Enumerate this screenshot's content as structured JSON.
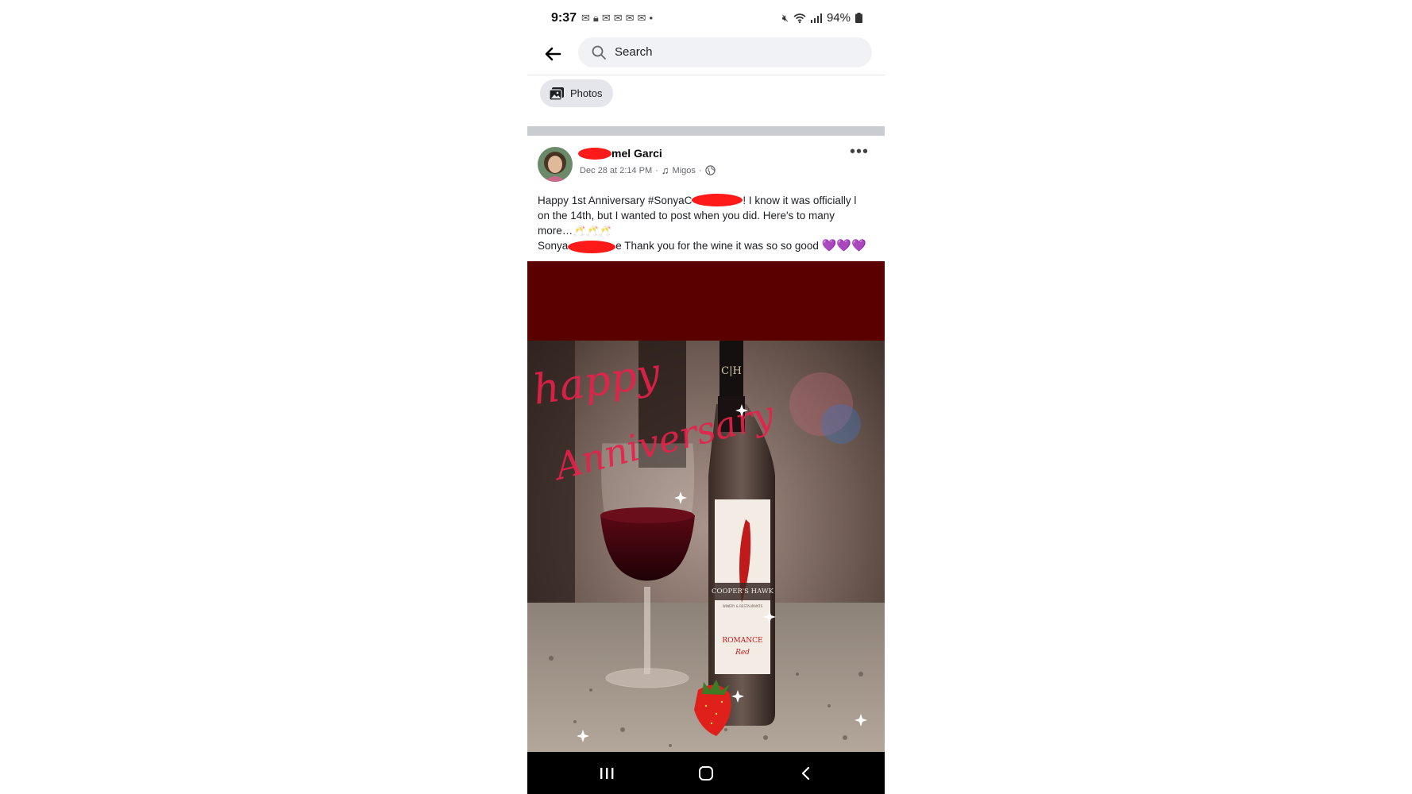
{
  "status_bar": {
    "time": "9:37",
    "notifications": [
      "gmail-icon",
      "lock-icon",
      "gmail-icon",
      "gmail-icon",
      "gmail-icon",
      "gmail-icon",
      "dot-icon"
    ],
    "battery": "94%"
  },
  "header": {
    "search_placeholder": "Search"
  },
  "filter": {
    "chip_label": "Photos"
  },
  "post": {
    "author_name": "mel Garci",
    "timestamp": "Dec 28 at 2:14 PM",
    "meta_separator": "·",
    "music_label": "Migos",
    "more_label": "•••",
    "caption_line1": "Happy 1st Anniversary #SonyaC",
    "caption_line1_tail": "! I know it was officially l",
    "caption_line2": "on the 14th, but I wanted to post when you did. Here's to many",
    "caption_line3": "more…",
    "caption_line3_emojis": "🥂🥂🥂",
    "caption_line4_start": "Sonya",
    "caption_line4_tail": "e Thank you for the wine it was so so good",
    "caption_line4_hearts": "💜💜💜"
  },
  "photo": {
    "script_line1": "happy",
    "script_line2": "Anniversary",
    "bottle_monogram": "C|H",
    "bottle_brand": "COOPER'S HAWK",
    "bottle_sub": "WINERY & RESTAURANTS",
    "bottle_wine": "ROMANCE",
    "bottle_wine2": "Red"
  },
  "colors": {
    "brand_dark_red": "#5a0000",
    "redaction": "#ff1a1a",
    "separator": "#c9ccd1",
    "heart_purple": "#8b2fc9"
  }
}
